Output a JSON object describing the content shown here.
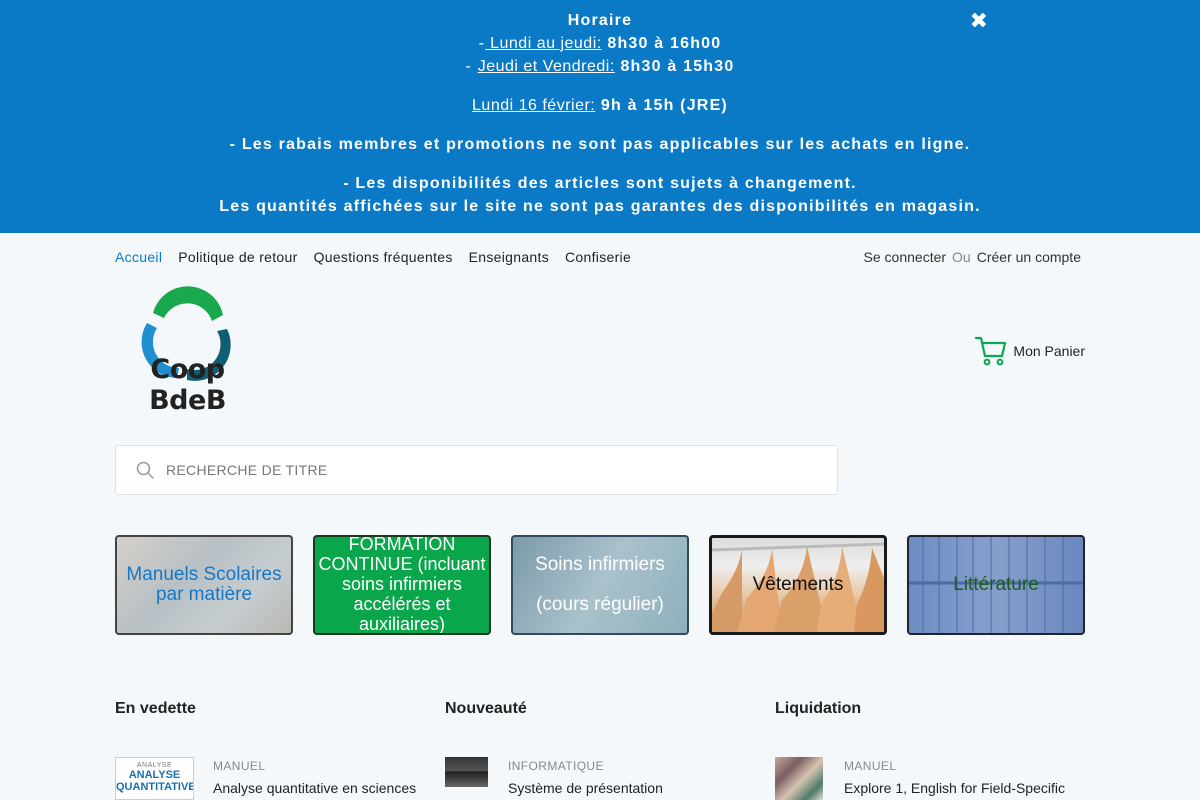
{
  "banner": {
    "title": "Horaire",
    "line1_label": " Lundi au jeudi:",
    "line1_value": "8h30 à 16h00",
    "line2_label": "Jeudi et Vendredi:",
    "line2_value": "8h30 à 15h30",
    "line3_label": "Lundi 16 février:",
    "line3_value": "9h à 15h (JRE)",
    "notice1": "- Les rabais membres et promotions ne sont pas applicables sur les achats en ligne.",
    "notice2a": "- Les disponibilités des articles sont sujets à changement.",
    "notice2b": "Les quantités affichées sur le site ne sont pas garantes des disponibilités en magasin.",
    "close_icon": "close-icon"
  },
  "topnav": {
    "items": [
      "Accueil",
      "Politique de retour",
      "Questions fréquentes",
      "Enseignants",
      "Confiserie"
    ]
  },
  "account": {
    "login": "Se connecter",
    "or": "Ou",
    "register": "Créer un compte"
  },
  "logo": {
    "text": "Coop BdeB"
  },
  "cart": {
    "label": "Mon Panier",
    "icon": "cart-icon"
  },
  "search": {
    "placeholder": "RECHERCHE DE TITRE"
  },
  "categories": [
    {
      "label": "Manuels Scolaires par matière"
    },
    {
      "label": "FORMATION CONTINUE (incluant soins infirmiers accélérés et auxiliaires)"
    },
    {
      "label_line1": "Soins infirmiers",
      "label_line2": "(cours régulier)"
    },
    {
      "label": "Vêtements"
    },
    {
      "label": "Littérature"
    }
  ],
  "sections": [
    {
      "title": "En vedette",
      "product": {
        "type": "Manuel",
        "name": "Analyse quantitative en sciences",
        "cover_text": "ANALYSE QUANTITATIVE"
      }
    },
    {
      "title": "Nouveauté",
      "product": {
        "type": "Informatique",
        "name": "Système de présentation"
      }
    },
    {
      "title": "Liquidation",
      "product": {
        "type": "Manuel",
        "name": "Explore 1, English for Field-Specific"
      }
    }
  ],
  "colors": {
    "banner": "#0a79c6",
    "accent_green": "#09a64b",
    "link_active": "#0a79c6"
  }
}
